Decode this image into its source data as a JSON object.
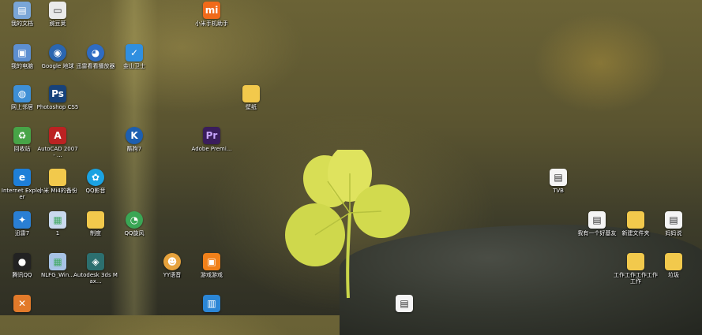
{
  "desktop_icons": [
    {
      "label": "我的文档",
      "glyph": "▤",
      "color": "#7aa6d8"
    },
    {
      "label": "我的电脑",
      "glyph": "▣",
      "color": "#5d8fd1"
    },
    {
      "label": "网上邻居",
      "glyph": "◍",
      "color": "#3e8fd6"
    },
    {
      "label": "回收站",
      "glyph": "♻",
      "color": "#47a447"
    },
    {
      "label": "Internet Explorer",
      "glyph": "e",
      "color": "#1e7fd8"
    },
    {
      "label": "迅雷7",
      "glyph": "✦",
      "color": "#2a7fd4"
    },
    {
      "label": "腾讯QQ",
      "glyph": "●",
      "color": "#222"
    },
    {
      "label": "豌豆荚",
      "glyph": "▭",
      "color": "#eaeaea"
    },
    {
      "label": "Google 地球",
      "glyph": "◉",
      "color": "#2b66b0"
    },
    {
      "label": "Photoshop CS5",
      "glyph": "Ps",
      "color": "#17427a"
    },
    {
      "label": "AutoCAD 2007 - ...",
      "glyph": "A",
      "color": "#b22"
    },
    {
      "label": "小米 Mi4的备份",
      "glyph": "▮",
      "color": "#f2c94c"
    },
    {
      "label": "1",
      "glyph": "▦",
      "color": "#c9d9ee"
    },
    {
      "label": "NLFG_Win...",
      "glyph": "▦",
      "color": "#a7c3e6"
    },
    {
      "label": "迅雷看看播放器",
      "glyph": "◕",
      "color": "#2f6cc3"
    },
    {
      "label": "酷狗7",
      "glyph": "K",
      "color": "#1d5fb0"
    },
    {
      "label": "QQ影音",
      "glyph": "✿",
      "color": "#1ba3e2"
    },
    {
      "label": "制度",
      "glyph": "▮",
      "color": "#f2c94c"
    },
    {
      "label": "Autodesk 3ds Max...",
      "glyph": "◈",
      "color": "#2c6f6f"
    },
    {
      "label": "金山卫士",
      "glyph": "✓",
      "color": "#2f8fe0"
    },
    {
      "label": "QQ旋风",
      "glyph": "◔",
      "color": "#3aa655"
    },
    {
      "label": "YY语音",
      "glyph": "☻",
      "color": "#e6a23c"
    },
    {
      "label": "小米手机助手",
      "glyph": "mi",
      "color": "#f06a1a"
    },
    {
      "label": "Adobe Premi...",
      "glyph": "Pr",
      "color": "#3a1d5c"
    },
    {
      "label": "游戏游戏",
      "glyph": "▣",
      "color": "#f0801a"
    },
    {
      "label": "",
      "glyph": "▥",
      "color": "#2b86d6"
    },
    {
      "label": "壁纸",
      "glyph": "▤",
      "color": "#f2c94c"
    },
    {
      "label": "TVB",
      "glyph": "▤",
      "color": "#f5f5f5"
    },
    {
      "label": "我有一个好基友",
      "glyph": "▤",
      "color": "#f5f5f5"
    },
    {
      "label": "新建文件夹",
      "glyph": "▮",
      "color": "#f2c94c"
    },
    {
      "label": "妈妈说",
      "glyph": "▤",
      "color": "#f5f5f5"
    },
    {
      "label": "工作工作工作工作工作",
      "glyph": "▮",
      "color": "#f2c94c"
    },
    {
      "label": "垃圾",
      "glyph": "▮",
      "color": "#f2c94c"
    },
    {
      "label": "",
      "glyph": "▤",
      "color": "#f5f5f5"
    }
  ]
}
